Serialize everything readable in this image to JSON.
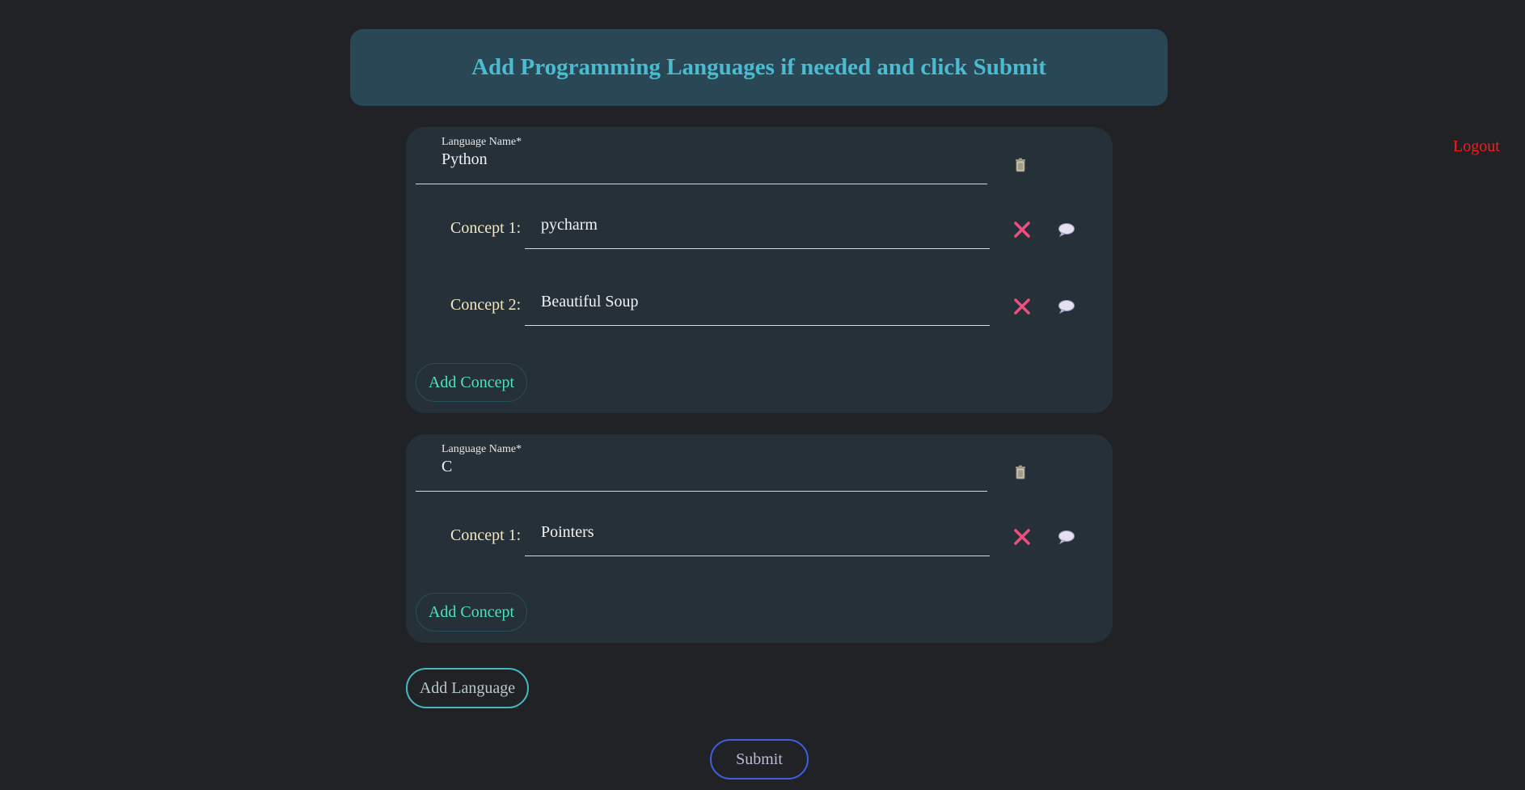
{
  "header": {
    "title": "Add Programming Languages if needed and click Submit"
  },
  "nav": {
    "logout_label": "Logout"
  },
  "languages": [
    {
      "name_label": "Language Name*",
      "name_value": "Python",
      "concepts": [
        {
          "label": "Concept 1:",
          "value": "pycharm"
        },
        {
          "label": "Concept 2:",
          "value": "Beautiful Soup"
        }
      ],
      "add_concept_label": "Add Concept"
    },
    {
      "name_label": "Language Name*",
      "name_value": "C",
      "concepts": [
        {
          "label": "Concept 1:",
          "value": "Pointers"
        }
      ],
      "add_concept_label": "Add Concept"
    }
  ],
  "actions": {
    "add_language_label": "Add Language",
    "submit_label": "Submit"
  },
  "icons": {
    "delete_language": "trash-icon",
    "remove_concept": "close-icon",
    "comment_concept": "speech-bubble-icon"
  },
  "colors": {
    "background": "#202226",
    "header_bg": "#294755",
    "header_text": "#4bbcd0",
    "card_bg": "#263039",
    "logout": "#ff1a1a",
    "concept_label": "#f4e7c6",
    "remove_icon": "#f04e7c",
    "add_concept_text": "#4fe0c0",
    "add_language_border": "#46b8c4",
    "submit_border": "#3f5fe0"
  }
}
